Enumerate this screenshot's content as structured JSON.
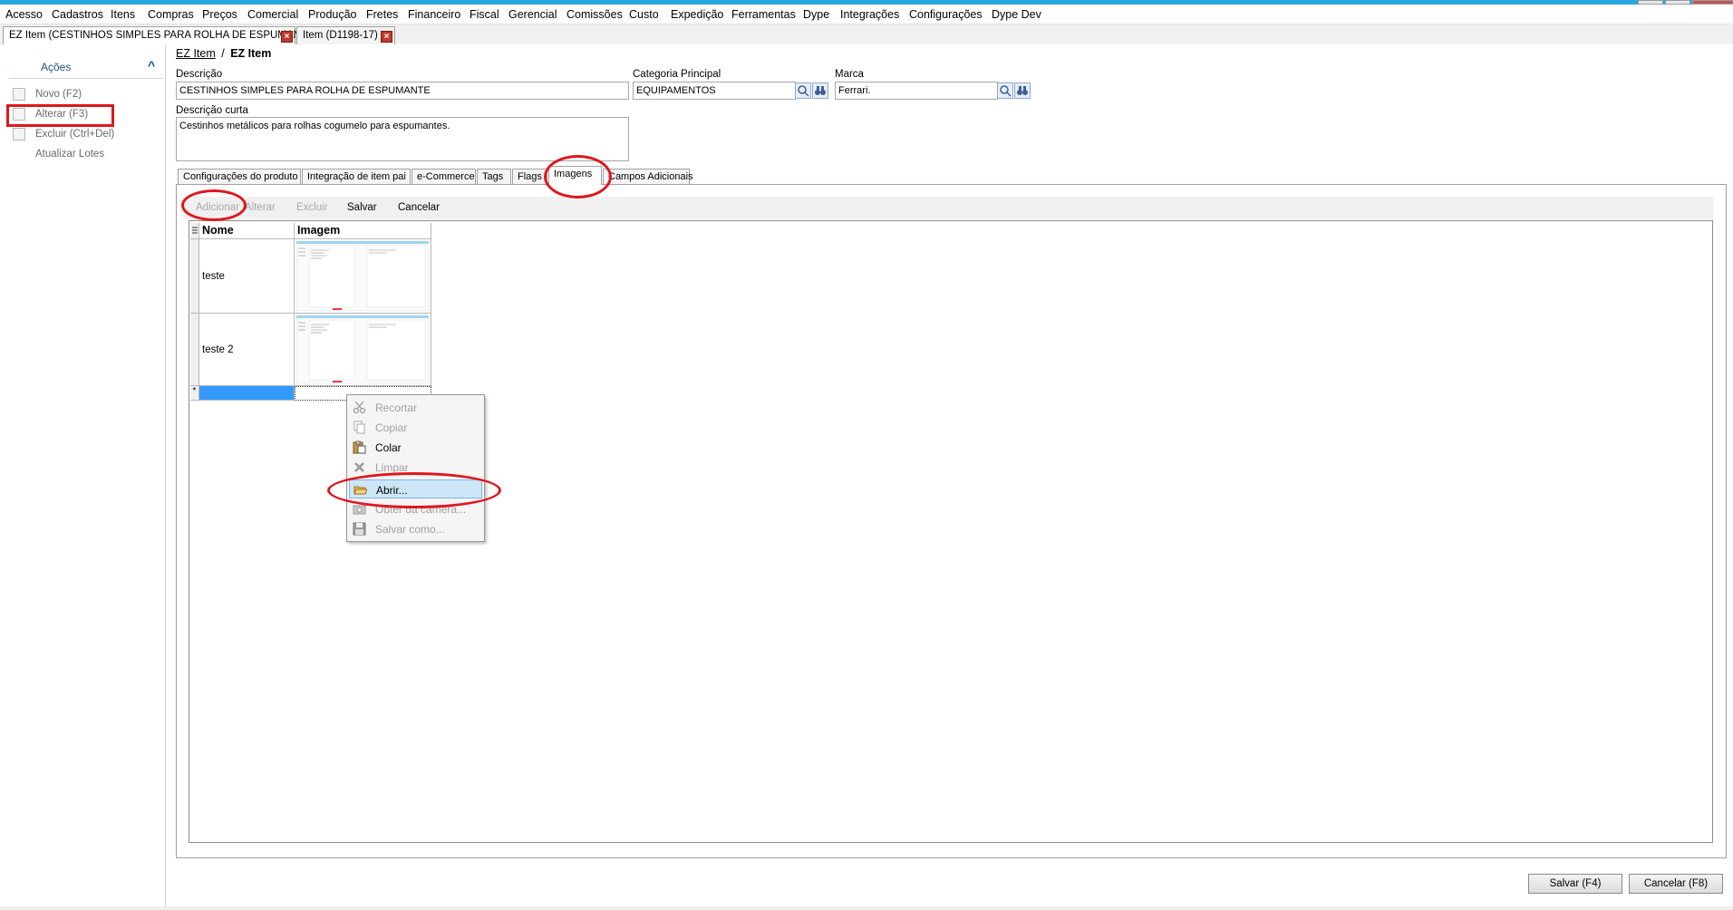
{
  "menu": [
    "Acesso",
    "Cadastros",
    "Itens",
    "Compras",
    "Preços",
    "Comercial",
    "Produção",
    "Fretes",
    "Financeiro",
    "Fiscal",
    "Gerencial",
    "Comissões",
    "Custo",
    "Expedição",
    "Ferramentas",
    "Dype",
    "Integrações",
    "Configurações",
    "Dype Dev"
  ],
  "doc_tabs": [
    {
      "label": "EZ Item (CESTINHOS SIMPLES PARA ROLHA DE ESPUMANTE)",
      "active": true
    },
    {
      "label": "Item (D1198-17)",
      "active": false
    }
  ],
  "actions": {
    "title": "Ações",
    "items": [
      {
        "label": "Novo (F2)",
        "icon": "new-document-icon"
      },
      {
        "label": "Alterar (F3)",
        "icon": "edit-document-icon"
      },
      {
        "label": "Excluir (Ctrl+Del)",
        "icon": "delete-document-icon"
      },
      {
        "label": "Atualizar Lotes",
        "icon": ""
      }
    ]
  },
  "breadcrumb": {
    "link": "EZ Item",
    "separator": "/",
    "current": "EZ Item"
  },
  "form": {
    "descricao_label": "Descrição",
    "descricao_value": "CESTINHOS SIMPLES PARA ROLHA DE ESPUMANTE",
    "categoria_label": "Categoria Principal",
    "categoria_value": "EQUIPAMENTOS",
    "marca_label": "Marca",
    "marca_value": "Ferrari.",
    "descricao_curta_label": "Descrição curta",
    "descricao_curta_value": "Cestinhos metálicos para rolhas cogumelo para espumantes."
  },
  "inner_tabs": [
    "Configurações do produto",
    "Integração de item pai",
    "e-Commerce",
    "Tags",
    "Flags",
    "Imagens",
    "Campos Adicionais"
  ],
  "active_inner_tab": "Imagens",
  "image_toolbar": {
    "add": "Adicionar",
    "edit": "Alterar",
    "delete": "Excluir",
    "save": "Salvar",
    "cancel": "Cancelar"
  },
  "grid": {
    "columns": [
      "Nome",
      "Imagem"
    ],
    "rows": [
      {
        "nome": "teste"
      },
      {
        "nome": "teste 2"
      }
    ],
    "new_row_marker": "*"
  },
  "context_menu": [
    {
      "label": "Recortar",
      "icon": "scissors-icon",
      "enabled": false
    },
    {
      "label": "Copiar",
      "icon": "copy-icon",
      "enabled": false
    },
    {
      "label": "Colar",
      "icon": "paste-icon",
      "enabled": true
    },
    {
      "label": "Limpar",
      "icon": "clear-icon",
      "enabled": false
    },
    {
      "label": "Abrir...",
      "icon": "folder-open-icon",
      "enabled": true,
      "highlighted": true
    },
    {
      "label": "Obter da câmera...",
      "icon": "camera-icon",
      "enabled": false
    },
    {
      "label": "Salvar como...",
      "icon": "save-disk-icon",
      "enabled": false
    }
  ],
  "bottom_buttons": {
    "save": "Salvar (F4)",
    "cancel": "Cancelar (F8)"
  },
  "colors": {
    "annotation": "#e0161d",
    "accent": "#29a8e0",
    "link_blue": "#1e4f8c"
  }
}
